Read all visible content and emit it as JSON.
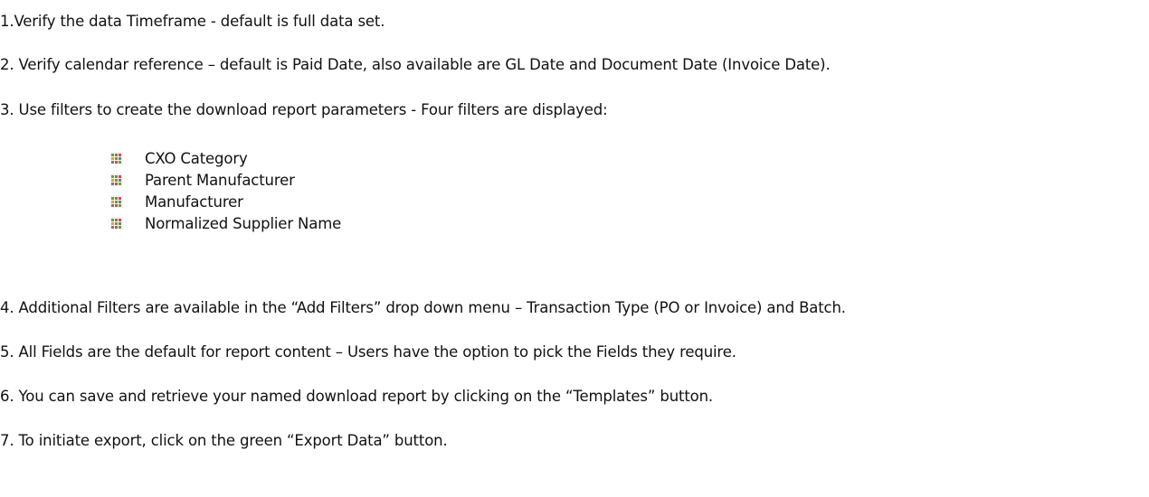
{
  "steps": [
    {
      "text": "1.Verify the data Timeframe - default is full data set."
    },
    {
      "text": "2. Verify calendar reference – default is Paid Date, also available are GL Date and Document Date (Invoice Date)."
    },
    {
      "text": "3. Use filters to create the download report parameters - Four filters are displayed:"
    },
    {
      "text": "4. Additional Filters are available in the “Add Filters” drop down menu – Transaction Type (PO or Invoice) and Batch."
    },
    {
      "text": "5. All Fields are the default for report content – Users have the option to pick the Fields they require."
    },
    {
      "text": "6. You can save and retrieve your named download report by clicking on the “Templates” button."
    },
    {
      "text": "7. To initiate export, click on the green “Export Data” button."
    }
  ],
  "filters": [
    {
      "label": "CXO Category",
      "icon": "filter-grid-icon"
    },
    {
      "label": "Parent Manufacturer",
      "icon": "filter-grid-icon"
    },
    {
      "label": "Manufacturer",
      "icon": "filter-grid-icon"
    },
    {
      "label": "Normalized Supplier Name",
      "icon": "filter-grid-icon"
    }
  ],
  "colors": {
    "text": "#111111",
    "icon_accents": [
      "#6a9e3f",
      "#d94c3d",
      "#e2a52c",
      "#7a7a7a"
    ]
  }
}
